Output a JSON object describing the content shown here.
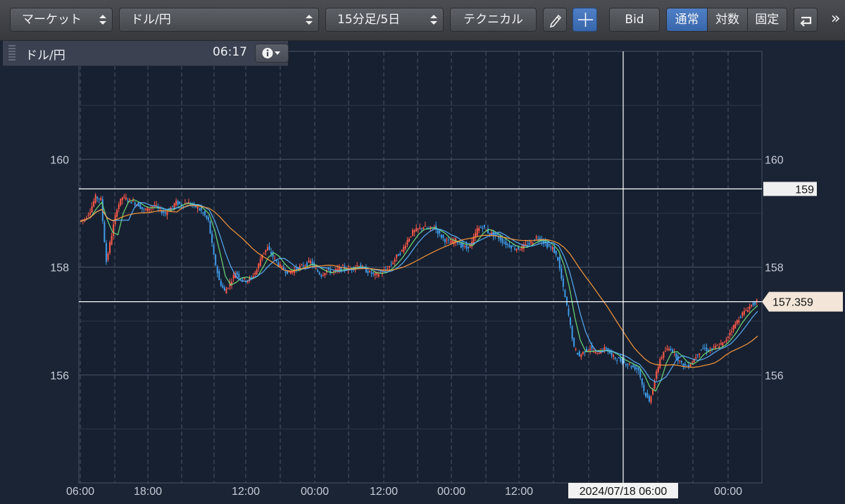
{
  "toolbar": {
    "market_select": "マーケット",
    "pair_select": "ドル/円",
    "interval_select": "15分足/5日",
    "technical_button": "テクニカル",
    "pencil_icon": "pencil-icon",
    "crosshair_icon": "crosshair-icon",
    "bid_button": "Bid",
    "scale_modes": [
      "通常",
      "対数",
      "固定"
    ],
    "scale_mode_active": "通常",
    "return_icon": "return-icon",
    "more_icon": "chevron-double-right-icon"
  },
  "infobar": {
    "symbol": "ドル/円",
    "time": "06:17",
    "info_icon": "info-icon"
  },
  "chart_data": {
    "type": "candlestick",
    "symbol": "ドル/円",
    "ylim": [
      154.0,
      162.0
    ],
    "y_ticks": [
      {
        "value": 160,
        "label": "160"
      },
      {
        "value": 158,
        "label": "158"
      },
      {
        "value": 156,
        "label": "156"
      }
    ],
    "x_ticks": [
      "06:00",
      "18:00",
      "12:00",
      "00:00",
      "12:00",
      "00:00",
      "12:00",
      "2024/07/18 06:00",
      "00:00"
    ],
    "crosshair": {
      "x_label": "2024/07/18 06:00",
      "y_label": "159",
      "y_value": 159.45
    },
    "current_price": {
      "label": "157.359",
      "value": 157.359
    },
    "price_path": [
      [
        0,
        158.85
      ],
      [
        1,
        158.9
      ],
      [
        2,
        159.05
      ],
      [
        3,
        159.3
      ],
      [
        4,
        159.25
      ],
      [
        5,
        158.1
      ],
      [
        6,
        158.6
      ],
      [
        7,
        159.1
      ],
      [
        8,
        159.3
      ],
      [
        9,
        159.25
      ],
      [
        10,
        159.2
      ],
      [
        11,
        159.15
      ],
      [
        12,
        159.05
      ],
      [
        13,
        159.1
      ],
      [
        14,
        159.15
      ],
      [
        15,
        159.05
      ],
      [
        16,
        159.0
      ],
      [
        17,
        159.1
      ],
      [
        18,
        159.2
      ],
      [
        19,
        159.15
      ],
      [
        20,
        159.2
      ],
      [
        21,
        159.15
      ],
      [
        22,
        159.1
      ],
      [
        23,
        159.0
      ],
      [
        24,
        158.85
      ],
      [
        25,
        158.2
      ],
      [
        26,
        157.75
      ],
      [
        27,
        157.55
      ],
      [
        28,
        157.7
      ],
      [
        29,
        157.9
      ],
      [
        30,
        157.8
      ],
      [
        31,
        157.75
      ],
      [
        32,
        157.8
      ],
      [
        33,
        157.95
      ],
      [
        34,
        158.25
      ],
      [
        35,
        158.35
      ],
      [
        36,
        158.2
      ],
      [
        37,
        158.05
      ],
      [
        38,
        157.95
      ],
      [
        39,
        157.9
      ],
      [
        40,
        157.95
      ],
      [
        41,
        158.0
      ],
      [
        42,
        158.05
      ],
      [
        43,
        158.1
      ],
      [
        44,
        157.95
      ],
      [
        45,
        157.85
      ],
      [
        46,
        157.95
      ],
      [
        47,
        157.9
      ],
      [
        48,
        157.95
      ],
      [
        49,
        158.0
      ],
      [
        50,
        157.95
      ],
      [
        51,
        158.0
      ],
      [
        52,
        158.05
      ],
      [
        53,
        157.95
      ],
      [
        54,
        157.9
      ],
      [
        55,
        157.85
      ],
      [
        56,
        157.9
      ],
      [
        57,
        157.95
      ],
      [
        58,
        158.05
      ],
      [
        59,
        158.2
      ],
      [
        60,
        158.3
      ],
      [
        61,
        158.5
      ],
      [
        62,
        158.65
      ],
      [
        63,
        158.7
      ],
      [
        64,
        158.75
      ],
      [
        65,
        158.7
      ],
      [
        66,
        158.75
      ],
      [
        67,
        158.6
      ],
      [
        68,
        158.5
      ],
      [
        69,
        158.45
      ],
      [
        70,
        158.5
      ],
      [
        71,
        158.4
      ],
      [
        72,
        158.35
      ],
      [
        73,
        158.45
      ],
      [
        74,
        158.7
      ],
      [
        75,
        158.75
      ],
      [
        76,
        158.65
      ],
      [
        77,
        158.6
      ],
      [
        78,
        158.55
      ],
      [
        79,
        158.45
      ],
      [
        80,
        158.4
      ],
      [
        81,
        158.35
      ],
      [
        82,
        158.35
      ],
      [
        83,
        158.4
      ],
      [
        84,
        158.45
      ],
      [
        85,
        158.55
      ],
      [
        86,
        158.5
      ],
      [
        87,
        158.4
      ],
      [
        88,
        158.35
      ],
      [
        89,
        158.15
      ],
      [
        90,
        157.6
      ],
      [
        91,
        157.1
      ],
      [
        92,
        156.5
      ],
      [
        93,
        156.35
      ],
      [
        94,
        156.45
      ],
      [
        95,
        156.5
      ],
      [
        96,
        156.4
      ],
      [
        97,
        156.45
      ],
      [
        98,
        156.5
      ],
      [
        99,
        156.35
      ],
      [
        100,
        156.3
      ],
      [
        101,
        156.25
      ],
      [
        102,
        156.2
      ],
      [
        103,
        156.15
      ],
      [
        104,
        156.1
      ],
      [
        105,
        155.7
      ],
      [
        106,
        155.5
      ],
      [
        107,
        155.9
      ],
      [
        108,
        156.3
      ],
      [
        109,
        156.45
      ],
      [
        110,
        156.5
      ],
      [
        111,
        156.35
      ],
      [
        112,
        156.2
      ],
      [
        113,
        156.15
      ],
      [
        114,
        156.25
      ],
      [
        115,
        156.4
      ],
      [
        116,
        156.5
      ],
      [
        117,
        156.45
      ],
      [
        118,
        156.5
      ],
      [
        119,
        156.55
      ],
      [
        120,
        156.6
      ],
      [
        121,
        156.8
      ],
      [
        122,
        156.95
      ],
      [
        123,
        157.1
      ],
      [
        124,
        157.2
      ],
      [
        125,
        157.3
      ],
      [
        126,
        157.359
      ]
    ],
    "ma_series": [
      {
        "name": "",
        "color": "#6fe07a",
        "period": 3
      },
      {
        "name": "",
        "color": "#5ab0ff",
        "period": 5
      },
      {
        "name": "",
        "color": "#ff9a3a",
        "period": 14
      }
    ]
  }
}
